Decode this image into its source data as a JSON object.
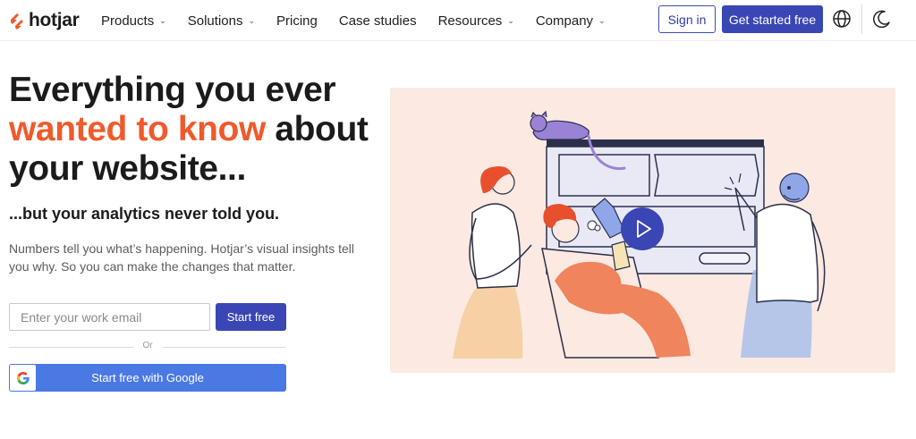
{
  "brand": {
    "name": "hotjar",
    "accent": "#ef5a2c",
    "primary": "#3a46b4"
  },
  "nav": {
    "items": [
      {
        "label": "Products",
        "dropdown": true
      },
      {
        "label": "Solutions",
        "dropdown": true
      },
      {
        "label": "Pricing",
        "dropdown": false
      },
      {
        "label": "Case studies",
        "dropdown": false
      },
      {
        "label": "Resources",
        "dropdown": true
      },
      {
        "label": "Company",
        "dropdown": true
      }
    ],
    "signin_label": "Sign in",
    "get_started_label": "Get started free",
    "language_icon": "globe-icon",
    "theme_icon": "moon-icon"
  },
  "hero": {
    "headline_line1": "Everything you ever",
    "headline_accent": "wanted to know",
    "headline_line2_rest": " about",
    "headline_line3": "your website...",
    "subhead": "...but your analytics never told you.",
    "description": "Numbers tell you what’s happening. Hotjar’s visual insights tell you why. So you can make the changes that matter.",
    "email_placeholder": "Enter your work email",
    "start_free_label": "Start free",
    "or_text": "Or",
    "google_label": "Start free with Google",
    "illustration_bg": "#fbe9e2",
    "play_icon": "play-icon"
  }
}
